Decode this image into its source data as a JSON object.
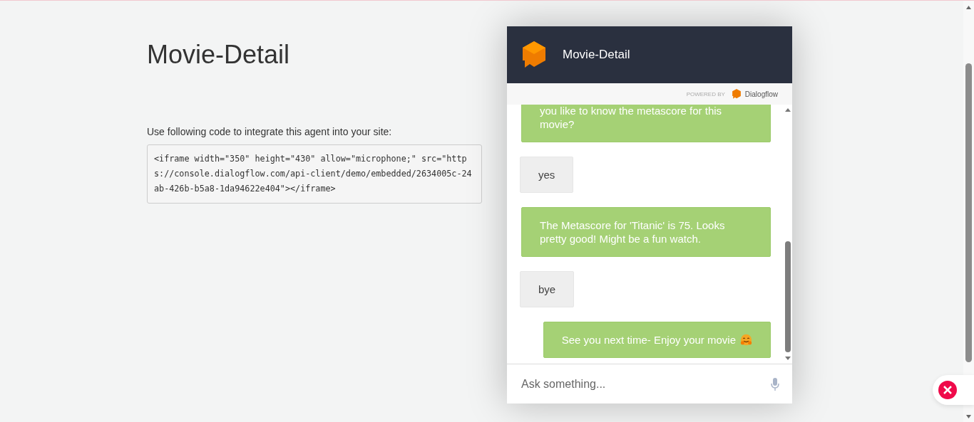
{
  "page": {
    "title": "Movie-Detail",
    "instruction": "Use following code to integrate this agent into your site:",
    "code": "<iframe width=\"350\" height=\"430\" allow=\"microphone;\" src=\"https://console.dialogflow.com/api-client/demo/embedded/2634005c-24ab-426b-b5a8-1da94622e404\"></iframe>"
  },
  "chat": {
    "title": "Movie-Detail",
    "powered_by": "POWERED BY",
    "brand": "Dialogflow",
    "messages": [
      {
        "kind": "bot",
        "text": "you like to know the metascore for this movie?"
      },
      {
        "kind": "user",
        "text": "yes"
      },
      {
        "kind": "bot",
        "text": "The Metascore for 'Titanic' is 75. Looks pretty good! Might be a fun watch."
      },
      {
        "kind": "user",
        "text": "bye"
      },
      {
        "kind": "bot",
        "text": "See you next time- Enjoy your movie",
        "emoji": true
      }
    ],
    "input": {
      "placeholder": "Ask something..."
    }
  }
}
